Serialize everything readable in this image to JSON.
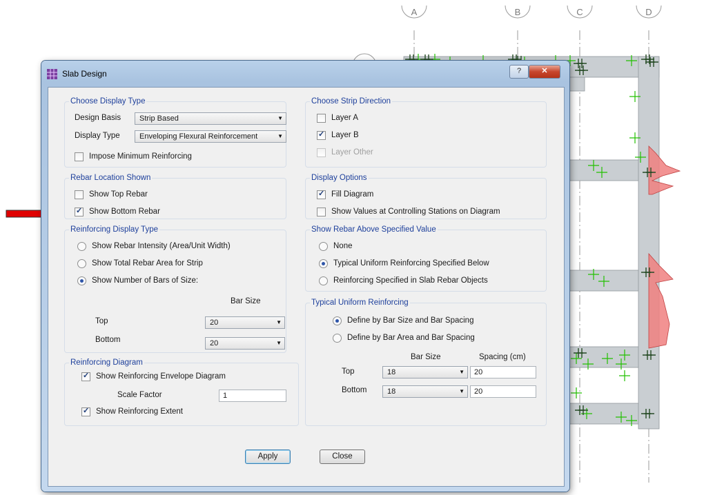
{
  "dialog": {
    "title": "Slab Design",
    "help_label": "?",
    "close_glyph": "✕",
    "apply_label": "Apply",
    "close_label": "Close"
  },
  "grid_labels": [
    "A",
    "B",
    "C",
    "D"
  ],
  "display_type_group": {
    "legend": "Choose Display Type",
    "design_basis_label": "Design Basis",
    "design_basis_value": "Strip Based",
    "display_type_label": "Display Type",
    "display_type_value": "Enveloping Flexural Reinforcement",
    "impose_min_label": "Impose Minimum Reinforcing",
    "impose_min_checked": false
  },
  "strip_direction_group": {
    "legend": "Choose Strip Direction",
    "layer_a_label": "Layer A",
    "layer_a_checked": false,
    "layer_b_label": "Layer B",
    "layer_b_checked": true,
    "layer_other_label": "Layer Other",
    "layer_other_enabled": false
  },
  "rebar_location_group": {
    "legend": "Rebar Location Shown",
    "top_label": "Show Top Rebar",
    "top_checked": false,
    "bottom_label": "Show Bottom Rebar",
    "bottom_checked": true
  },
  "display_options_group": {
    "legend": "Display Options",
    "fill_label": "Fill Diagram",
    "fill_checked": true,
    "values_label": "Show Values at Controlling Stations on Diagram",
    "values_checked": false
  },
  "reinf_display_group": {
    "legend": "Reinforcing Display Type",
    "opt1_label": "Show Rebar Intensity (Area/Unit Width)",
    "opt2_label": "Show Total Rebar Area for Strip",
    "opt3_label": "Show Number of Bars of Size:",
    "selected": 3,
    "bar_size_header": "Bar Size",
    "top_label": "Top",
    "top_value": "20",
    "bottom_label": "Bottom",
    "bottom_value": "20"
  },
  "rebar_above_group": {
    "legend": "Show Rebar Above Specified Value",
    "opt1_label": "None",
    "opt2_label": "Typical Uniform Reinforcing Specified Below",
    "opt3_label": "Reinforcing Specified in Slab Rebar Objects",
    "selected": 2
  },
  "typical_uniform_group": {
    "legend": "Typical Uniform Reinforcing",
    "opt1_label": "Define by Bar Size and Bar Spacing",
    "opt2_label": "Define by Bar Area and Bar Spacing",
    "selected": 1,
    "bar_size_header": "Bar Size",
    "spacing_header": "Spacing  (cm)",
    "top_label": "Top",
    "top_bar": "18",
    "top_spacing": "20",
    "bottom_label": "Bottom",
    "bottom_bar": "18",
    "bottom_spacing": "20"
  },
  "reinf_diagram_group": {
    "legend": "Reinforcing Diagram",
    "envelope_label": "Show Reinforcing Envelope Diagram",
    "envelope_checked": true,
    "scale_label": "Scale Factor",
    "scale_value": "1",
    "extent_label": "Show Reinforcing Extent",
    "extent_checked": true
  },
  "colors": {
    "legend_blue": "#1d3f9b",
    "arrow_red": "#e00000",
    "rebar_green": "#22c000",
    "diagram_pink": "#f08080"
  }
}
